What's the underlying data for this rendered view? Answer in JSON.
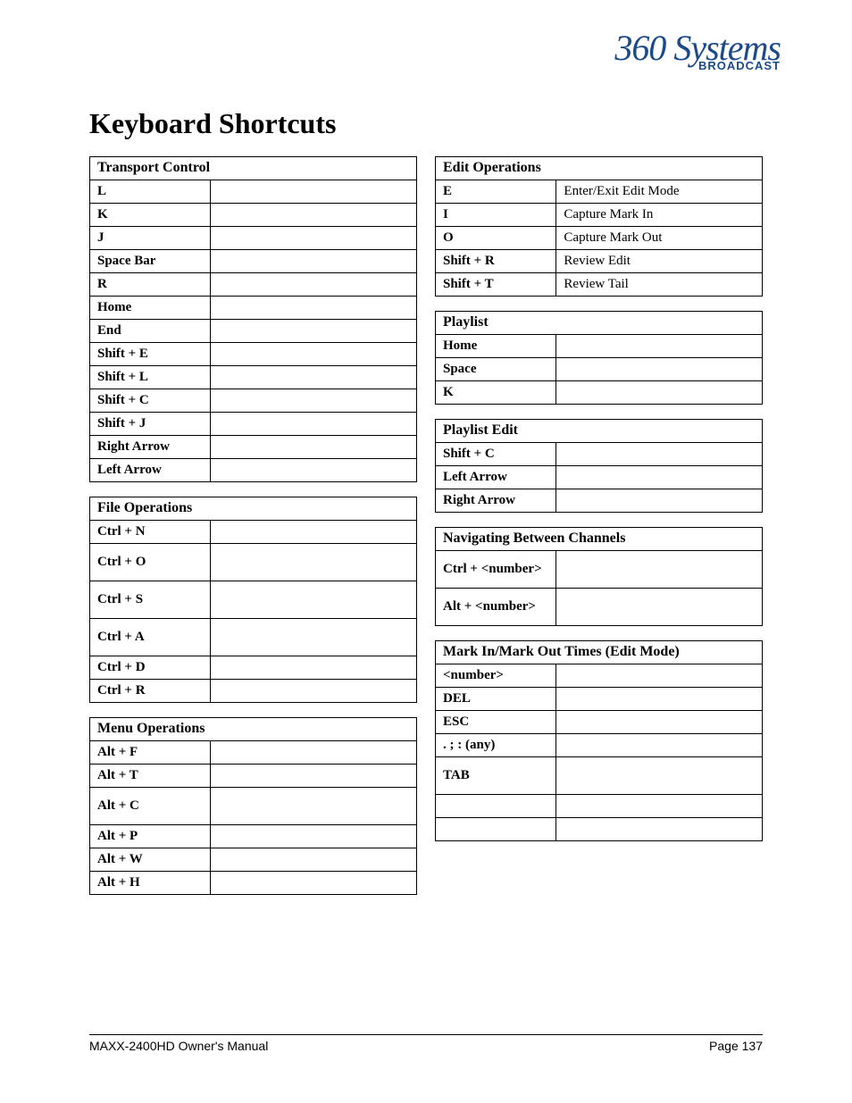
{
  "logo": {
    "script": "360 Systems",
    "sub": "BROADCAST"
  },
  "heading": "Keyboard Shortcuts",
  "left": [
    {
      "title": "Transport Control",
      "rows": [
        {
          "key": "L",
          "desc": ""
        },
        {
          "key": "K",
          "desc": ""
        },
        {
          "key": "J",
          "desc": ""
        },
        {
          "key": "Space Bar",
          "desc": ""
        },
        {
          "key": "R",
          "desc": ""
        },
        {
          "key": "Home",
          "desc": ""
        },
        {
          "key": "End",
          "desc": ""
        },
        {
          "key": "Shift + E",
          "desc": ""
        },
        {
          "key": "Shift + L",
          "desc": ""
        },
        {
          "key": "Shift + C",
          "desc": ""
        },
        {
          "key": "Shift + J",
          "desc": ""
        },
        {
          "key": "Right Arrow",
          "desc": ""
        },
        {
          "key": "Left Arrow",
          "desc": ""
        }
      ]
    },
    {
      "title": "File Operations",
      "rows": [
        {
          "key": "Ctrl + N",
          "desc": ""
        },
        {
          "key": "Ctrl + O",
          "desc": "",
          "tall": true
        },
        {
          "key": "Ctrl + S",
          "desc": "",
          "tall": true
        },
        {
          "key": "Ctrl + A",
          "desc": "",
          "tall": true
        },
        {
          "key": "Ctrl + D",
          "desc": ""
        },
        {
          "key": "Ctrl + R",
          "desc": ""
        }
      ]
    },
    {
      "title": "Menu Operations",
      "rows": [
        {
          "key": "Alt + F",
          "desc": ""
        },
        {
          "key": "Alt + T",
          "desc": ""
        },
        {
          "key": "Alt + C",
          "desc": "",
          "tall": true
        },
        {
          "key": "Alt + P",
          "desc": ""
        },
        {
          "key": "Alt + W",
          "desc": ""
        },
        {
          "key": "Alt + H",
          "desc": ""
        }
      ]
    }
  ],
  "right": [
    {
      "title": "Edit Operations",
      "rows": [
        {
          "key": "E",
          "desc": "Enter/Exit Edit Mode"
        },
        {
          "key": "I",
          "desc": "Capture Mark In"
        },
        {
          "key": "O",
          "desc": "Capture Mark Out"
        },
        {
          "key": "Shift + R",
          "desc": "Review Edit"
        },
        {
          "key": "Shift + T",
          "desc": "Review Tail"
        }
      ]
    },
    {
      "title": "Playlist",
      "rows": [
        {
          "key": "Home",
          "desc": ""
        },
        {
          "key": "Space",
          "desc": ""
        },
        {
          "key": "K",
          "desc": ""
        }
      ]
    },
    {
      "title": "Playlist Edit",
      "rows": [
        {
          "key": "Shift + C",
          "desc": ""
        },
        {
          "key": "Left Arrow",
          "desc": ""
        },
        {
          "key": "Right Arrow",
          "desc": ""
        }
      ]
    },
    {
      "title": "Navigating Between Channels",
      "rows": [
        {
          "key": "Ctrl + <number>",
          "desc": "",
          "tall": true
        },
        {
          "key": "Alt + <number>",
          "desc": "",
          "tall": true
        }
      ]
    },
    {
      "title": "Mark In/Mark Out Times (Edit Mode)",
      "rows": [
        {
          "key": "<number>",
          "desc": ""
        },
        {
          "key": "DEL",
          "desc": ""
        },
        {
          "key": "ESC",
          "desc": ""
        },
        {
          "key": ". ; :  (any)",
          "desc": ""
        },
        {
          "key": "TAB",
          "desc": "",
          "tall": true
        },
        {
          "key": "",
          "desc": ""
        },
        {
          "key": "",
          "desc": ""
        }
      ]
    }
  ],
  "footer": {
    "left": "MAXX-2400HD Owner's Manual",
    "right": "Page 137"
  }
}
